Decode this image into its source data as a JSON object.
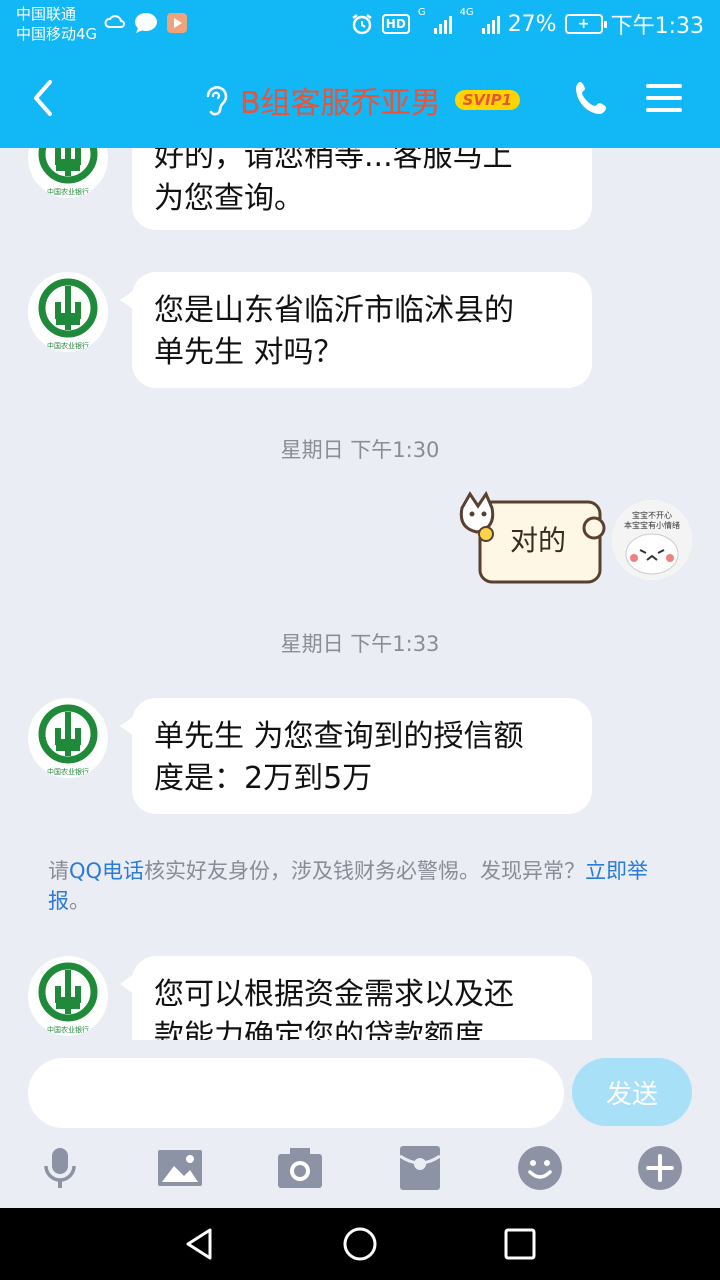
{
  "status_bar": {
    "carrier_1": "中国联通",
    "carrier_2": "中国移动4G",
    "net_1": "G",
    "net_2": "4G",
    "battery": "27%",
    "time": "下午1:33",
    "hd": "HD"
  },
  "header": {
    "title": "B组客服乔亚男",
    "badge": "SVIP1",
    "title_color": "#e8533a",
    "bar_color": "#12b7f5"
  },
  "messages": [
    {
      "text_line1": "好的，请您稍等...客服马上",
      "text_line2": "为您查询。"
    },
    {
      "text_line1": "您是山东省临沂市临沭县的",
      "text_line2": "单先生 对吗？"
    },
    {
      "timestamp": "星期日 下午1:30"
    },
    {
      "sticker_text": "对的",
      "avatar_caption_1": "宝宝不开心",
      "avatar_caption_2": "本宝宝有小情绪"
    },
    {
      "timestamp": "星期日 下午1:33"
    },
    {
      "text_line1": "单先生 为您查询到的授信额",
      "text_line2": "度是：2万到5万"
    },
    {
      "text_line1": "您可以根据资金需求以及还",
      "text_line2": "款能力确定您的贷款额度"
    }
  ],
  "warning": {
    "prefix": "请",
    "link1": "QQ电话",
    "middle": "核实好友身份，涉及钱财务必警惕。发现异常？",
    "link2": "立即举报",
    "suffix": "。"
  },
  "avatar_logo_text": "中国农业银行",
  "input": {
    "placeholder": "",
    "send_label": "发送"
  },
  "toolbar_icons": [
    "microphone-icon",
    "image-icon",
    "camera-icon",
    "red-packet-icon",
    "emoji-icon",
    "plus-icon"
  ]
}
